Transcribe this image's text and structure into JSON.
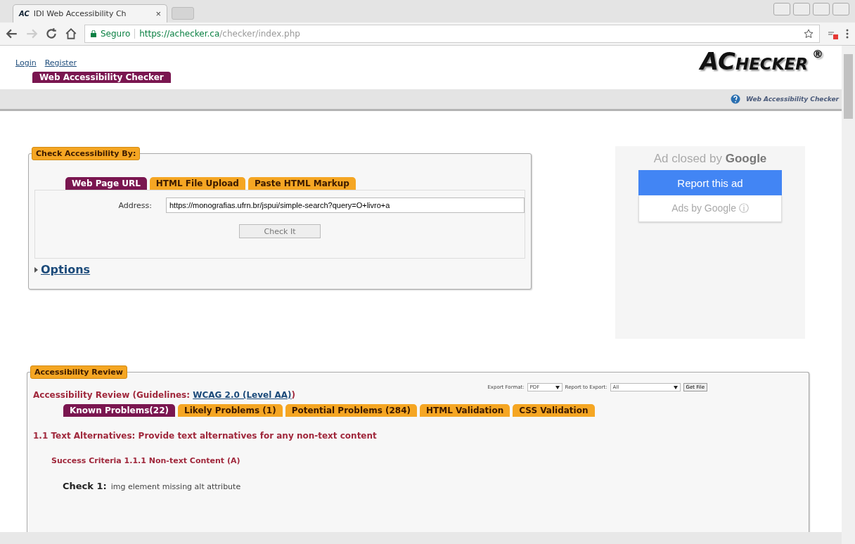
{
  "browser": {
    "tab": {
      "icon_text": "AC",
      "title": "IDI Web Accessibility Ch",
      "close": "×"
    },
    "address": {
      "secure_label": "Seguro",
      "url_host": "https://achecker.ca",
      "url_path": "/checker/index.php"
    }
  },
  "header": {
    "links": [
      "Login",
      "Register"
    ],
    "banner": "Web Accessibility Checker",
    "logo": {
      "initials": "AC",
      "rest": "HECKER",
      "mark": "®"
    },
    "help_link": "Web Accessibility Checker"
  },
  "check_form": {
    "legend": "Check Accessibility By:",
    "tabs": [
      {
        "label": "Web Page URL",
        "selected": true
      },
      {
        "label": "HTML File Upload",
        "selected": false
      },
      {
        "label": "Paste HTML Markup",
        "selected": false
      }
    ],
    "address_label": "Address:",
    "address_value": "https://monografias.ufrn.br/jspui/simple-search?query=O+livro+a",
    "submit": "Check It",
    "options": "Options"
  },
  "ad": {
    "closed_by": "Ad closed by",
    "brand": "Google",
    "report": "Report this ad",
    "ads_by": "Ads by Google ⓘ"
  },
  "review": {
    "legend": "Accessibility Review",
    "export_label": "Export Format:",
    "export_format": "PDF",
    "report_label": "Report to Export:",
    "report_value": "All",
    "get_file": "Get File",
    "heading": "Accessibility Review (Guidelines: ",
    "guideline_link": "WCAG 2.0 (Level AA)",
    "heading_end": ")",
    "tabs": [
      {
        "label": "Known Problems(22)",
        "selected": true
      },
      {
        "label": "Likely Problems (1)",
        "selected": false
      },
      {
        "label": "Potential Problems (284)",
        "selected": false
      },
      {
        "label": "HTML Validation",
        "selected": false
      },
      {
        "label": "CSS Validation",
        "selected": false
      }
    ],
    "section": "1.1 Text Alternatives: Provide text alternatives for any non-text content",
    "criteria": "Success Criteria 1.1.1 Non-text Content (A)",
    "check_label": "Check 1:",
    "check_text": "img element missing alt attribute"
  }
}
